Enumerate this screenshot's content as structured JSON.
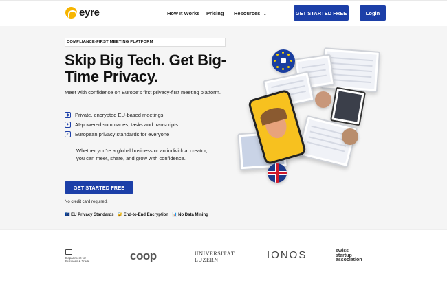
{
  "header": {
    "logo_text": "eyre",
    "nav": [
      {
        "label": "How It Works"
      },
      {
        "label": "Pricing"
      },
      {
        "label": "Resources"
      }
    ],
    "cta_label": "GET STARTED FREE",
    "login_label": "Login"
  },
  "hero": {
    "tag": "COMPLIANCE-FIRST MEETING PLATFORM",
    "headline": "Skip Big Tech. Get Big-Time Privacy.",
    "subheading": "Meet with confidence on Europe's first privacy-first meeting platform.",
    "features": [
      "Private, encrypted EU-based meetings",
      "AI-powered summaries, tasks and transcripts",
      "European privacy standards for everyone"
    ],
    "description": "Whether you're a global business or an individual creator, you can meet, share, and grow with confidence.",
    "cta_label": "GET STARTED FREE",
    "no_card": "No credit card required.",
    "badges": [
      "🇪🇺 EU Privacy Standards",
      "🔐 End-to-End Encryption",
      "📊 No Data Mining"
    ]
  },
  "logos": {
    "dbt": [
      "Department for",
      "Business & Trade"
    ],
    "coop": "coop",
    "uni": [
      "UNIVERSITÄT",
      "LUZERN"
    ],
    "ionos": "IONOS",
    "swiss": [
      "swiss",
      "startup",
      "association"
    ]
  },
  "colors": {
    "brand_blue": "#1c3fa8",
    "logo_yellow": "#f7b500"
  },
  "icons": [
    "eyre-logo-icon",
    "chevron-down-icon",
    "shield-icon",
    "sparkle-icon",
    "check-icon",
    "lock-icon",
    "eu-flag-icon",
    "uk-flag-icon"
  ]
}
